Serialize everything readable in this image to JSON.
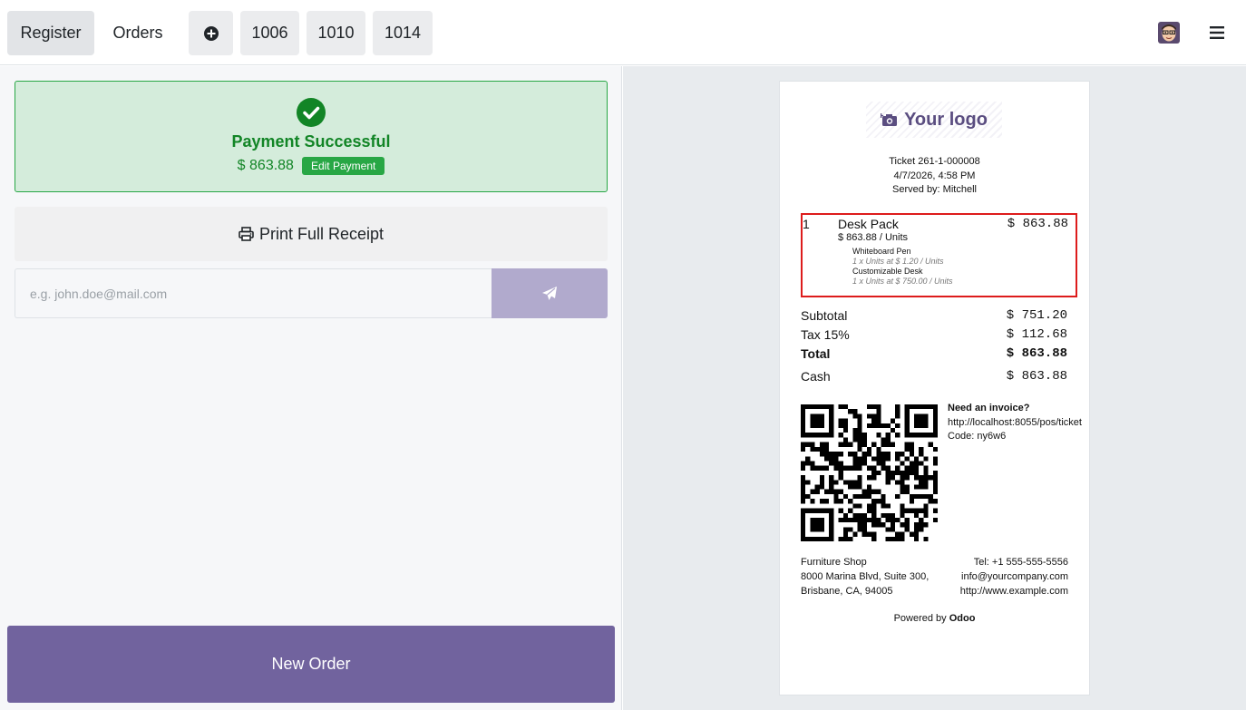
{
  "navbar": {
    "register_label": "Register",
    "orders_label": "Orders",
    "order_tabs": [
      "1006",
      "1010",
      "1014"
    ]
  },
  "payment": {
    "status_title": "Payment Successful",
    "amount": "$ 863.88",
    "edit_label": "Edit Payment",
    "print_label": "Print Full Receipt",
    "email_placeholder": "e.g. john.doe@mail.com",
    "new_order_label": "New Order"
  },
  "receipt": {
    "logo_text": "Your logo",
    "ticket": "Ticket 261-1-000008",
    "datetime": "4/7/2026, 4:58 PM",
    "served_by": "Served by: Mitchell",
    "line": {
      "qty": "1",
      "name": "Desk Pack",
      "price": "$ 863.88",
      "unit_price": "$ 863.88 / Units",
      "components": [
        {
          "name": "Whiteboard Pen",
          "detail": "1 x Units at $ 1.20 / Units"
        },
        {
          "name": "Customizable Desk",
          "detail": "1 x Units at $ 750.00 / Units"
        }
      ]
    },
    "totals": {
      "subtotal_label": "Subtotal",
      "subtotal": "$ 751.20",
      "tax_label": "Tax 15%",
      "tax": "$ 112.68",
      "total_label": "Total",
      "total": "$ 863.88",
      "cash_label": "Cash",
      "cash": "$ 863.88"
    },
    "invoice": {
      "title": "Need an invoice?",
      "url": "http://localhost:8055/pos/ticket",
      "code": "Code: ny6w6"
    },
    "company": {
      "name": "Furniture Shop",
      "address1": "8000 Marina Blvd, Suite 300,",
      "address2": "Brisbane, CA, 94005",
      "phone": "Tel: +1 555-555-5556",
      "email": "info@yourcompany.com",
      "website": "http://www.example.com"
    },
    "powered_prefix": "Powered by",
    "powered_brand": "Odoo"
  },
  "colors": {
    "accent": "#71639e",
    "success": "#28a745",
    "highlight_border": "#dd1c1c"
  }
}
